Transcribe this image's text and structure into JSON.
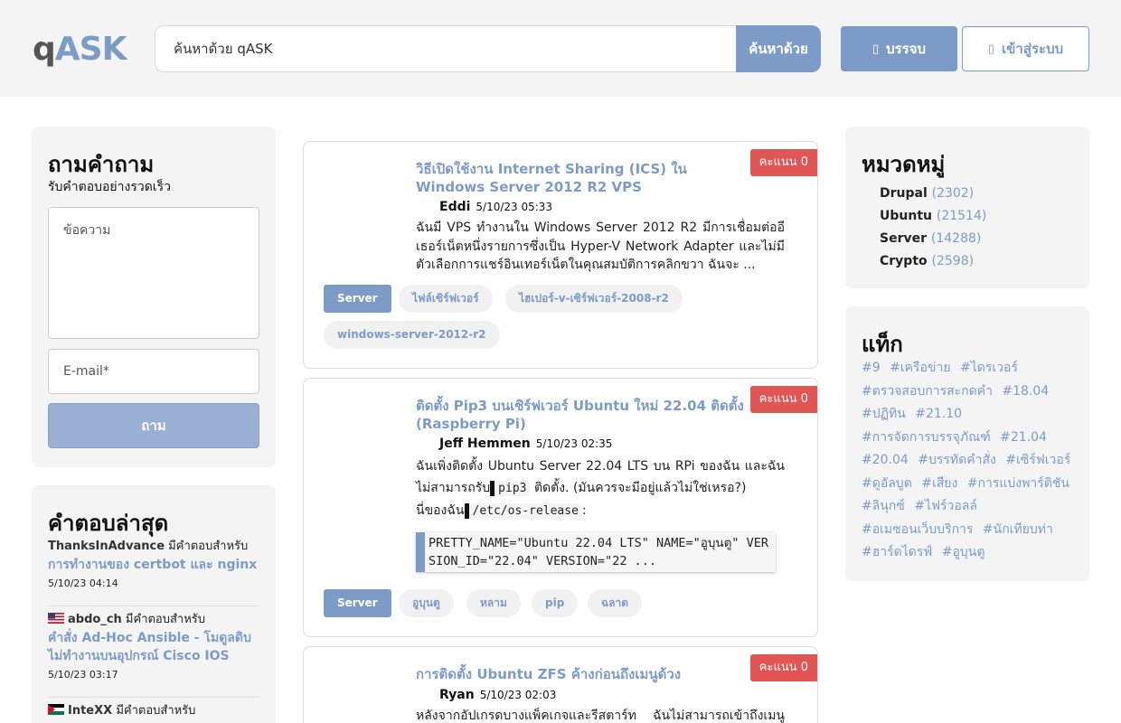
{
  "header": {
    "logo_q": "q",
    "logo_ask": "ASK",
    "search_placeholder": "ค้นหาด้วย qASK",
    "search_button": "ค้นหาด้วย",
    "register_label": "บรรจบ",
    "login_label": "เข้าสู่ระบบ"
  },
  "ask": {
    "title": "ถามคำถาม",
    "subtitle": "รับคำตอบอย่างรวดเร็ว",
    "message_placeholder": "ข้อความ",
    "email_placeholder": "E-mail*",
    "button": "ถาม"
  },
  "latest_answers": {
    "title": "คำตอบล่าสุด",
    "has_answer_for": "มีคำตอบสำหรับ",
    "items": [
      {
        "user": "ThanksInAdvance",
        "link": "การทำงานของ certbot และ nginx",
        "date": "5/10/23 04:14",
        "flag": "none"
      },
      {
        "user": "abdo_ch",
        "link": "คำสั่ง Ad-Hoc Ansible - โมดูลดิบไม่ทำงานบนอุปกรณ์ Cisco IOS",
        "date": "5/10/23 03:17",
        "flag": "us"
      },
      {
        "user": "InteXX",
        "link": "",
        "date": "",
        "flag": "jo"
      }
    ]
  },
  "questions": [
    {
      "score": "คะแนน 0",
      "title": "วิธีเปิดใช้งาน Internet Sharing (ICS) ใน Windows Server 2012 R2 VPS",
      "author": "Eddi",
      "date": "5/10/23 05:33",
      "excerpt": "ฉันมี VPS ทำงานใน Windows Server 2012 R2 มีการเชื่อมต่ออีเธอร์เน็ตหนึ่งรายการซึ่งเป็น Hyper-V Network Adapter และไม่มีตัวเลือกการแชร์อินเทอร์เน็ตในคุณสมบัติการคลิกขวา ฉันจะ ...",
      "category": "Server",
      "tags": [
        "ไฟล์เซิร์ฟเวอร์",
        "ไฮเปอร์-v-เซิร์ฟเวอร์-2008-r2",
        "windows-server-2012-r2"
      ]
    },
    {
      "score": "คะแนน 0",
      "title": "ติดตั้ง Pip3 บนเซิร์ฟเวอร์ Ubuntu ใหม่ 22.04 ติดตั้ง (Raspberry Pi)",
      "author": "Jeff Hemmen",
      "date": "5/10/23 02:35",
      "excerpt_a": "ฉันเพิ่งติดตั้ง Ubuntu Server 22.04 LTS บน RPi ของฉัน และฉันไม่สามารถรับ",
      "code_inline_1": "pip3",
      "excerpt_b": "ติดตั้ง. (มันควรจะมีอยู่แล้วไม่ใช่เหรอ?)",
      "excerpt_c": "นี่ของฉัน",
      "code_inline_2": "/etc/os-release",
      "excerpt_d": ":",
      "code_block": "PRETTY_NAME=\"Ubuntu 22.04 LTS\" NAME=\"อูบุนตู\" VERSION_ID=\"22.04\" VERSION=\"22 ...",
      "category": "Server",
      "tags": [
        "อูบุนตู",
        "หลาม",
        "pip",
        "ฉลาด"
      ]
    },
    {
      "score": "คะแนน 0",
      "title": "การติดตั้ง Ubuntu ZFS ค้างก่อนถึงเมนูด้วง",
      "author": "Ryan",
      "date": "5/10/23 02:03",
      "excerpt": "หลังจากอัปเกรดบางแพ็คเกจและรีสตาร์ท ฉันไม่สามารถเข้าถึงเมนูด้วงได้"
    }
  ],
  "categories": {
    "title": "หมวดหมู่",
    "items": [
      {
        "name": "Drupal",
        "count": "(2302)"
      },
      {
        "name": "Ubuntu",
        "count": "(21514)"
      },
      {
        "name": "Server",
        "count": "(14288)"
      },
      {
        "name": "Crypto",
        "count": "(2598)"
      }
    ]
  },
  "tags": {
    "title": "แท็ก",
    "items": [
      "#9",
      "#เครือข่าย",
      "#ไดรเวอร์",
      "#ตรวจสอบการสะกดคำ",
      "#18.04",
      "#ปฏิทิน",
      "#21.10",
      "#การจัดการบรรจุภัณฑ์",
      "#21.04",
      "#20.04",
      "#บรรทัดคำสั่ง",
      "#เซิร์ฟเวอร์",
      "#ดูอัลบูต",
      "#เสียง",
      "#การแบ่งพาร์ติชัน",
      "#ลินุกซ์",
      "#ไฟร์วอลล์",
      "#อเมซอนเว็บบริการ",
      "#นักเทียบท่า",
      "#ฮาร์ดไดรฟ์",
      "#อูบุนตู"
    ]
  },
  "colors": {
    "accent": "#7d9bc7",
    "score_badge": "#e25555",
    "panel_bg": "#f4f4f4"
  },
  "icons": {
    "register": "user-plus-icon",
    "login": "sign-in-icon"
  }
}
